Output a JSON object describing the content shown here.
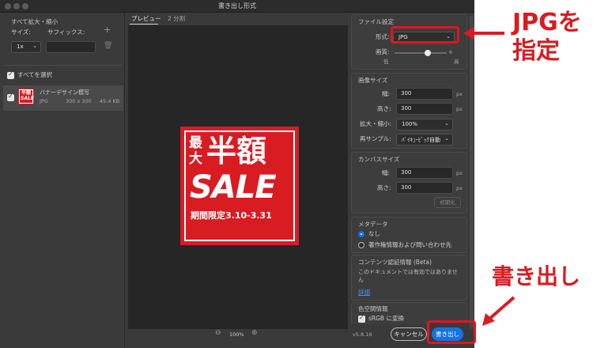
{
  "window": {
    "title": "書き出し形式"
  },
  "left_panel": {
    "section_title": "すべて拡大・縮小",
    "size_label": "サイズ:",
    "suffix_label": "サフィックス:",
    "add_icon": "plus-icon",
    "scale_value": "1x",
    "select_all_label": "すべてを選択",
    "asset": {
      "thumb_line1": "半額",
      "thumb_line2": "SALE",
      "name": "バナーデザイン模写",
      "format": "JPG",
      "dimensions": "300 x 300",
      "size": "45.4 KB"
    }
  },
  "preview": {
    "tabs": [
      "プレビュー",
      "2 分割"
    ],
    "zoom": "100%",
    "banner": {
      "line1a": "最",
      "line1b": "大",
      "line1c": "半額",
      "line2": "SALE",
      "line3": "期間限定3.10-3.31"
    }
  },
  "file_settings": {
    "title": "ファイル設定",
    "format_label": "形式:",
    "format_value": "JPG",
    "quality_label": "画質:",
    "quality_value": "6",
    "quality_fraction": 0.64,
    "quality_low": "低",
    "quality_high": "高"
  },
  "image_size": {
    "title": "画像サイズ",
    "width_label": "幅:",
    "width_value": "300",
    "height_label": "高さ:",
    "height_value": "300",
    "unit": "px",
    "scale_label": "拡大・縮小:",
    "scale_value": "100%",
    "resample_label": "再サンプル:",
    "resample_value": "ﾊﾞｲｷｭｰﾋﾞｯｸ自動"
  },
  "canvas_size": {
    "title": "カンバスサイズ",
    "width_label": "幅:",
    "width_value": "300",
    "height_label": "高さ:",
    "height_value": "300",
    "unit": "px",
    "reset_label": "初期化"
  },
  "metadata": {
    "title": "メタデータ",
    "option_none": "なし",
    "option_copyright": "著作権情報および問い合わせ先"
  },
  "content_credentials": {
    "title": "コンテンツ認証情報 (Beta)",
    "text_line1": "このドキュメントでは有効ではありませ",
    "text_line2": "ん",
    "link": "詳細"
  },
  "color_space": {
    "title": "色空間情報",
    "convert_label": "sRGB に変換"
  },
  "footer": {
    "version": "v5.8.18",
    "cancel": "キャンセル",
    "export": "書き出し"
  },
  "annotations": {
    "jpg_line1": "JPGを",
    "jpg_line2": "指定",
    "export": "書き出し"
  },
  "colors": {
    "accent_blue": "#1473e6",
    "annotation_red": "#d81c22",
    "panel_bg": "#3a3a3a"
  }
}
